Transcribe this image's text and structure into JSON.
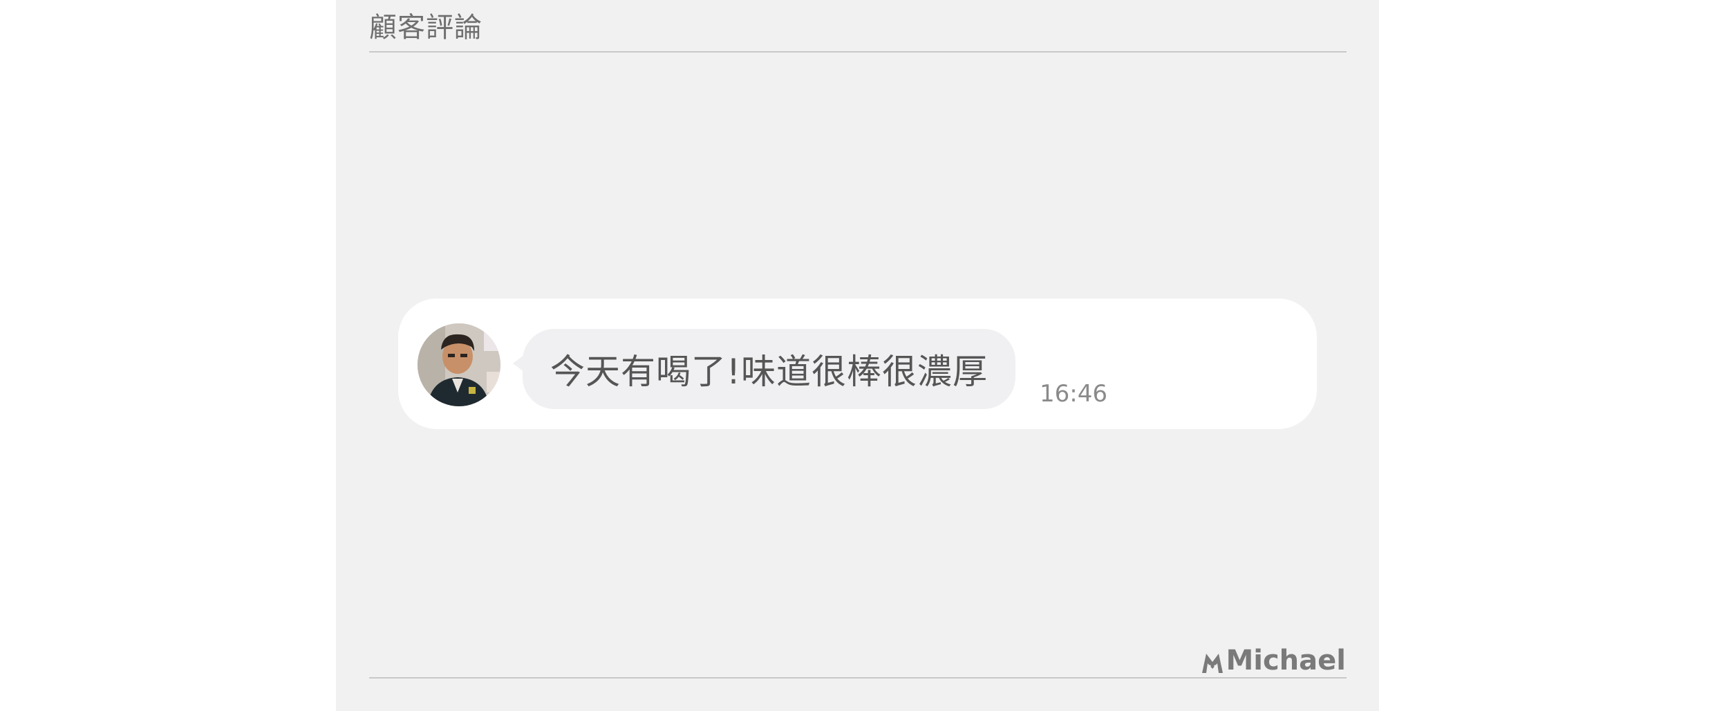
{
  "section": {
    "title": "顧客評論"
  },
  "review": {
    "avatar_label": "customer-avatar",
    "message": "今天有喝了!味道很棒很濃厚",
    "time": "16:46"
  },
  "watermark": {
    "text": "Michael"
  },
  "colors": {
    "panel_bg": "#f1f1f1",
    "card_bg": "#ffffff",
    "bubble_bg": "#f0f0f2",
    "text_main": "#555555",
    "text_muted": "#8a8a8a"
  }
}
